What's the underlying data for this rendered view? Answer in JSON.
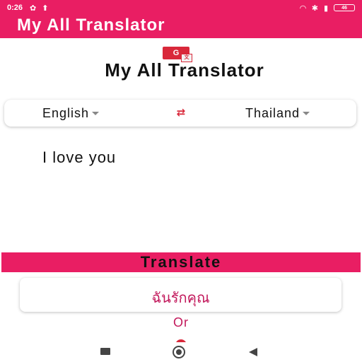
{
  "status": {
    "time": "0:26",
    "icons": [
      "gear-icon",
      "upload-icon",
      "wifi-icon",
      "bluetooth-icon",
      "signal-icon",
      "battery-icon"
    ],
    "battery_label": "46"
  },
  "appbar": {
    "title": "My All Translator"
  },
  "header": {
    "logo_text": "G",
    "logo_fold": "文",
    "title": "My All Translator"
  },
  "languages": {
    "from": "English",
    "to": "Thailand",
    "swap_icon": "swap-arrows-icon"
  },
  "input": {
    "text": "I love you"
  },
  "actions": {
    "translate_label": "Translate"
  },
  "result": {
    "text": "ฉันรักคุณ"
  },
  "separator": {
    "or_label": "Or"
  },
  "colors": {
    "primary": "#e91e63",
    "accent": "#d9283a",
    "result_text": "#c2185b"
  }
}
